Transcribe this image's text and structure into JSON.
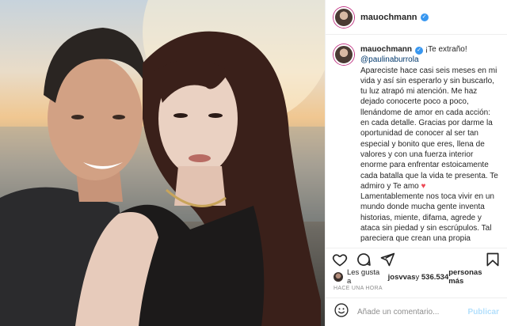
{
  "post": {
    "username": "mauochmann",
    "verified_mark": "✓",
    "caption": {
      "username": "mauochmann",
      "intro": " ¡Te extraño! ",
      "mention": "@paulinaburrola",
      "text": "Apareciste hace casi seis meses en mi vida y así sin esperarlo y sin buscarlo, tu luz atrapó mi atención. Me haz dejado conocerte poco a poco, llenándome de amor en cada acción: en cada detalle. Gracias por darme la oportunidad de conocer al ser tan especial y bonito que eres, llena de valores y con una fuerza interior enorme para enfrentar estoicamente cada batalla que la vida te presenta. Te admiro y Te amo ",
      "heart": "♥",
      "text2": "Lamentablemente nos toca vivir en un mundo donde mucha gente inventa historias, miente, difama, agrede y ataca sin piedad y sin escrúpulos. Tal pareciera que crean una propia"
    },
    "likes": {
      "prefix": "Les gusta a ",
      "user": "josvvas",
      "middle": " y ",
      "count": "536.534",
      "suffix": " personas más"
    },
    "timestamp": "HACE UNA HORA",
    "comment": {
      "placeholder": "Añade un comentario...",
      "publish_label": "Publicar"
    }
  },
  "icons": [
    "heart-icon",
    "comment-icon",
    "share-icon",
    "bookmark-icon",
    "emoji-icon",
    "more-icon"
  ],
  "colors": {
    "verified": "#3897f0",
    "mention": "#00376b",
    "heart": "#ed4956",
    "publish": "#b2dffc"
  }
}
